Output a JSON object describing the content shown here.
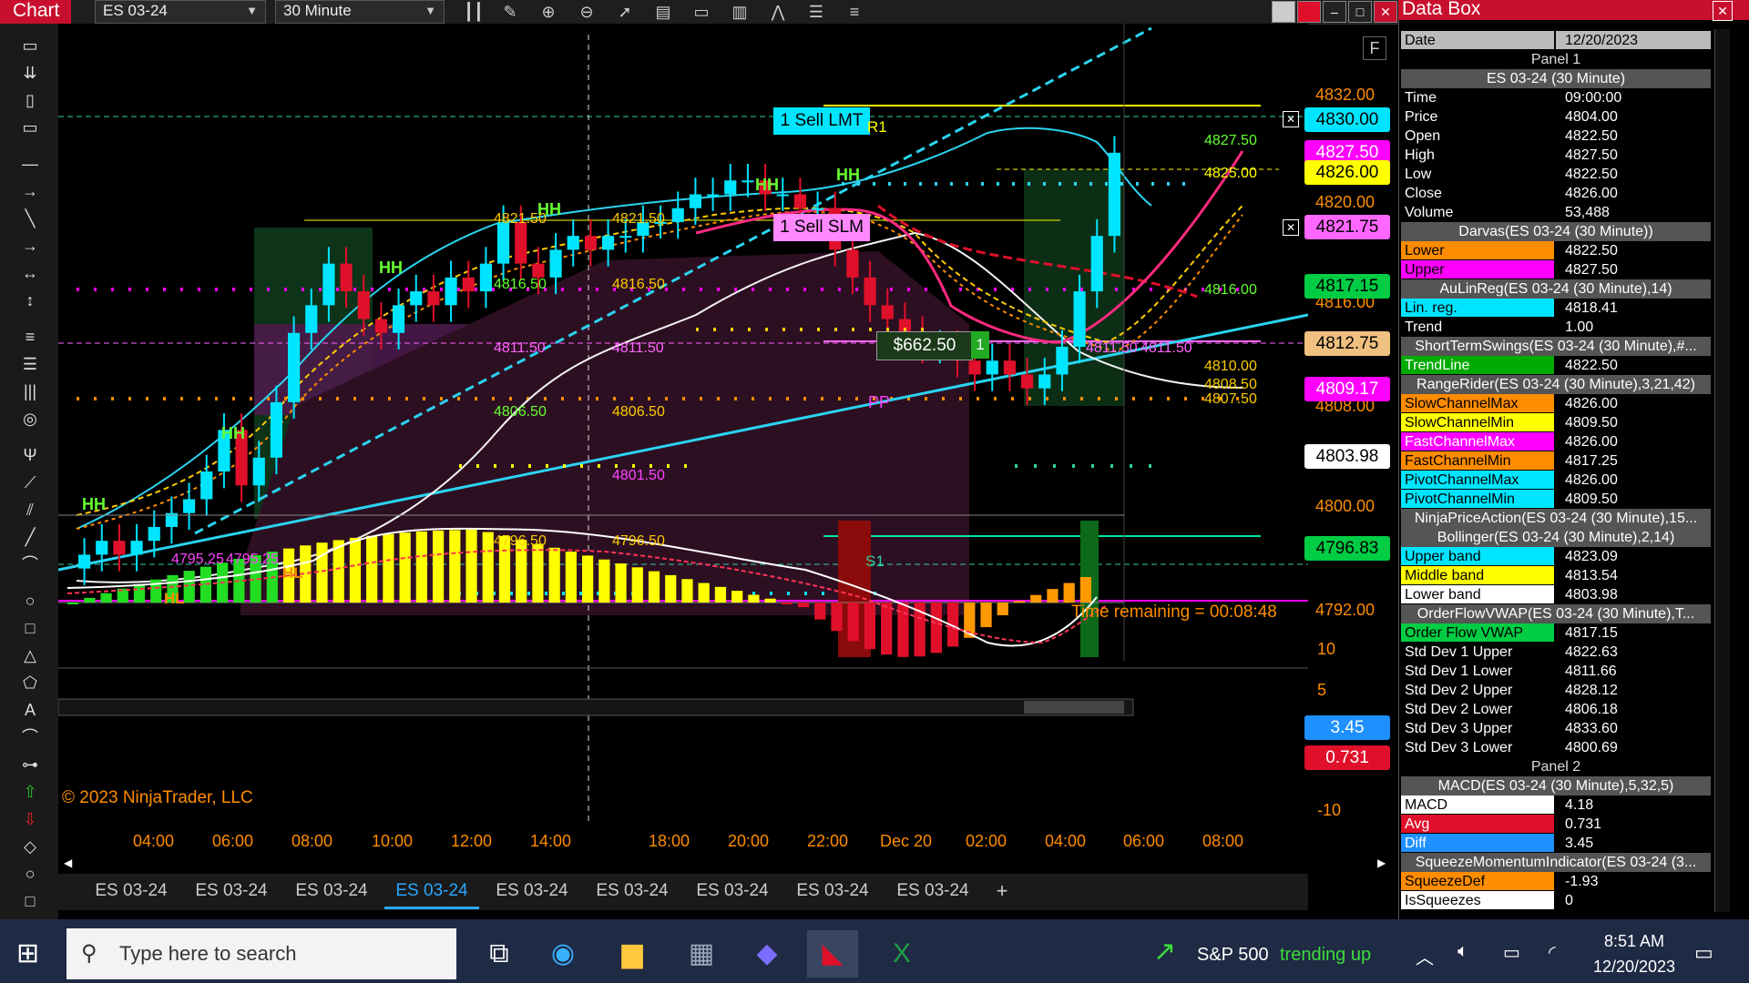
{
  "toolbar": {
    "chart_tab": "Chart",
    "instrument": "ES 03-24",
    "interval": "30 Minute"
  },
  "chart": {
    "copyright": "© 2023 NinjaTrader, LLC",
    "time_remaining": "Time remaining = 00:08:48",
    "f_label": "F",
    "orders": {
      "sell_lmt": "1 Sell LMT",
      "sell_slm": "1 Sell SLM"
    },
    "position": {
      "pnl": "$662.50",
      "qty": "1"
    },
    "pivots": {
      "r1": "R1",
      "pp": "PP",
      "s1": "S1"
    },
    "swing_labels": [
      "HH",
      "HH",
      "HH",
      "HH",
      "HH",
      "HH",
      "HL",
      "HL"
    ],
    "level_labels": [
      "4821.50",
      "4821.50",
      "4816.50",
      "4816.50",
      "4811.50",
      "4811.50",
      "4806.50",
      "4806.50",
      "4801.50",
      "4796.50",
      "4796.50",
      "4795.25",
      "4795.25",
      "4827.50",
      "4825.00",
      "4816.00",
      "4811.50",
      "4811.50",
      "4810.00",
      "4808.50",
      "4807.50"
    ],
    "price_axis": [
      "4832.00",
      "4828.00",
      "4824.00",
      "4820.00",
      "4816.00",
      "4812.00",
      "4808.00",
      "4800.00",
      "4796.00",
      "4792.00"
    ],
    "price_tags": [
      {
        "text": "4830.00",
        "bg": "#00e5ff",
        "fg": "#000"
      },
      {
        "text": "4827.50",
        "bg": "#ff00ff",
        "fg": "#fff"
      },
      {
        "text": "4826.00",
        "bg": "#ffff00",
        "fg": "#000"
      },
      {
        "text": "4821.75",
        "bg": "#ff66ff",
        "fg": "#000"
      },
      {
        "text": "4817.15",
        "bg": "#00cc44",
        "fg": "#000"
      },
      {
        "text": "4812.75",
        "bg": "#f0c080",
        "fg": "#000"
      },
      {
        "text": "4809.17",
        "bg": "#ff00ff",
        "fg": "#fff"
      },
      {
        "text": "4803.98",
        "bg": "#ffffff",
        "fg": "#000"
      },
      {
        "text": "4796.83",
        "bg": "#00cc44",
        "fg": "#000"
      }
    ],
    "macd_axis": [
      "10",
      "5",
      "-5",
      "-10"
    ],
    "macd_tags": [
      {
        "text": "3.45",
        "bg": "#1e90ff",
        "fg": "#fff"
      },
      {
        "text": "0.731",
        "bg": "#e0102a",
        "fg": "#fff"
      }
    ],
    "time_axis": [
      "04:00",
      "06:00",
      "08:00",
      "10:00",
      "12:00",
      "14:00",
      "18:00",
      "20:00",
      "22:00",
      "Dec 20",
      "02:00",
      "04:00",
      "06:00",
      "08:00"
    ]
  },
  "chart_data": {
    "type": "candlestick",
    "title": "",
    "ylim": [
      4790,
      4834
    ],
    "close": [
      4797,
      4798,
      4797,
      4798,
      4799,
      4800,
      4801,
      4803,
      4806,
      4802,
      4804,
      4808,
      4813,
      4815,
      4818,
      4816,
      4814,
      4813,
      4815,
      4816,
      4815,
      4817,
      4816,
      4818,
      4821,
      4818,
      4817,
      4819,
      4820,
      4819,
      4820,
      4820,
      4821,
      4821,
      4822,
      4823,
      4823,
      4824,
      4824,
      4823,
      4823,
      4822,
      4822,
      4819,
      4817,
      4815,
      4814,
      4813,
      4812,
      4812,
      4811,
      4810,
      4811,
      4810,
      4809,
      4810,
      4812,
      4816,
      4820,
      4826
    ]
  },
  "tabs": [
    "ES 03-24",
    "ES 03-24",
    "ES 03-24",
    "ES 03-24",
    "ES 03-24",
    "ES 03-24",
    "ES 03-24",
    "ES 03-24",
    "ES 03-24"
  ],
  "tab_add": "+",
  "databox": {
    "title": "Data Box",
    "rows": [
      {
        "k": "Date",
        "v": "12/20/2023",
        "kbg": "#bbb",
        "vbg": "#bbb",
        "kc": "#000",
        "vc": "#000"
      },
      {
        "head": "Panel 1",
        "panel": true
      },
      {
        "head": "ES 03-24 (30 Minute)"
      },
      {
        "k": "Time",
        "v": "09:00:00"
      },
      {
        "k": "Price",
        "v": "4804.00"
      },
      {
        "k": "Open",
        "v": "4822.50"
      },
      {
        "k": "High",
        "v": "4827.50"
      },
      {
        "k": "Low",
        "v": "4822.50"
      },
      {
        "k": "Close",
        "v": "4826.00"
      },
      {
        "k": "Volume",
        "v": "53,488"
      },
      {
        "head": "Darvas(ES 03-24 (30 Minute))"
      },
      {
        "k": "Lower",
        "v": "4822.50",
        "kbg": "#ff8c00",
        "kc": "#000"
      },
      {
        "k": "Upper",
        "v": "4827.50",
        "kbg": "#ff00ff",
        "kc": "#000"
      },
      {
        "head": "AuLinReg(ES 03-24 (30 Minute),14)"
      },
      {
        "k": "Lin. reg.",
        "v": "4818.41",
        "kbg": "#00e5ff",
        "kc": "#000"
      },
      {
        "k": "Trend",
        "v": "1.00"
      },
      {
        "head": "ShortTermSwings(ES 03-24 (30 Minute),#..."
      },
      {
        "k": "TrendLine",
        "v": "4822.50",
        "kbg": "#00aa00",
        "kc": "#fff"
      },
      {
        "head": "RangeRider(ES 03-24 (30 Minute),3,21,42)"
      },
      {
        "k": "SlowChannelMax",
        "v": "4826.00",
        "kbg": "#ff8c00",
        "kc": "#000"
      },
      {
        "k": "SlowChannelMin",
        "v": "4809.50",
        "kbg": "#ffff00",
        "kc": "#000"
      },
      {
        "k": "FastChannelMax",
        "v": "4826.00",
        "kbg": "#ff00ff",
        "kc": "#fff"
      },
      {
        "k": "FastChannelMin",
        "v": "4817.25",
        "kbg": "#ff8c00",
        "kc": "#000"
      },
      {
        "k": "PivotChannelMax",
        "v": "4826.00",
        "kbg": "#00e5ff",
        "kc": "#000"
      },
      {
        "k": "PivotChannelMin",
        "v": "4809.50",
        "kbg": "#00e5ff",
        "kc": "#000"
      },
      {
        "head": "NinjaPriceAction(ES 03-24 (30 Minute),15..."
      },
      {
        "head": "Bollinger(ES 03-24 (30 Minute),2,14)"
      },
      {
        "k": "Upper band",
        "v": "4823.09",
        "kbg": "#00e5ff",
        "kc": "#000"
      },
      {
        "k": "Middle band",
        "v": "4813.54",
        "kbg": "#ffff00",
        "kc": "#000"
      },
      {
        "k": "Lower band",
        "v": "4803.98",
        "kbg": "#ffffff",
        "kc": "#000"
      },
      {
        "head": "OrderFlowVWAP(ES 03-24 (30 Minute),T..."
      },
      {
        "k": "Order Flow VWAP",
        "v": "4817.15",
        "kbg": "#00cc44",
        "kc": "#000"
      },
      {
        "k": "Std Dev 1 Upper",
        "v": "4822.63"
      },
      {
        "k": "Std Dev 1 Lower",
        "v": "4811.66"
      },
      {
        "k": "Std Dev 2 Upper",
        "v": "4828.12"
      },
      {
        "k": "Std Dev 2 Lower",
        "v": "4806.18"
      },
      {
        "k": "Std Dev 3 Upper",
        "v": "4833.60"
      },
      {
        "k": "Std Dev 3 Lower",
        "v": "4800.69"
      },
      {
        "head": "Panel 2",
        "panel": true
      },
      {
        "head": "MACD(ES 03-24 (30 Minute),5,32,5)"
      },
      {
        "k": "MACD",
        "v": "4.18",
        "kbg": "#ffffff",
        "kc": "#000"
      },
      {
        "k": "Avg",
        "v": "0.731",
        "kbg": "#e0102a",
        "kc": "#fff"
      },
      {
        "k": "Diff",
        "v": "3.45",
        "kbg": "#1e90ff",
        "kc": "#fff"
      },
      {
        "head": "SqueezeMomentumIndicator(ES 03-24 (3..."
      },
      {
        "k": "SqueezeDef",
        "v": "-1.93",
        "kbg": "#ff8c00",
        "kc": "#000"
      },
      {
        "k": "IsSqueezes",
        "v": "0",
        "kbg": "#ffffff",
        "kc": "#000"
      }
    ]
  },
  "taskbar": {
    "search_placeholder": "Type here to search",
    "news_title": "S&P 500",
    "news_status": "trending up",
    "time": "8:51 AM",
    "date": "12/20/2023"
  }
}
